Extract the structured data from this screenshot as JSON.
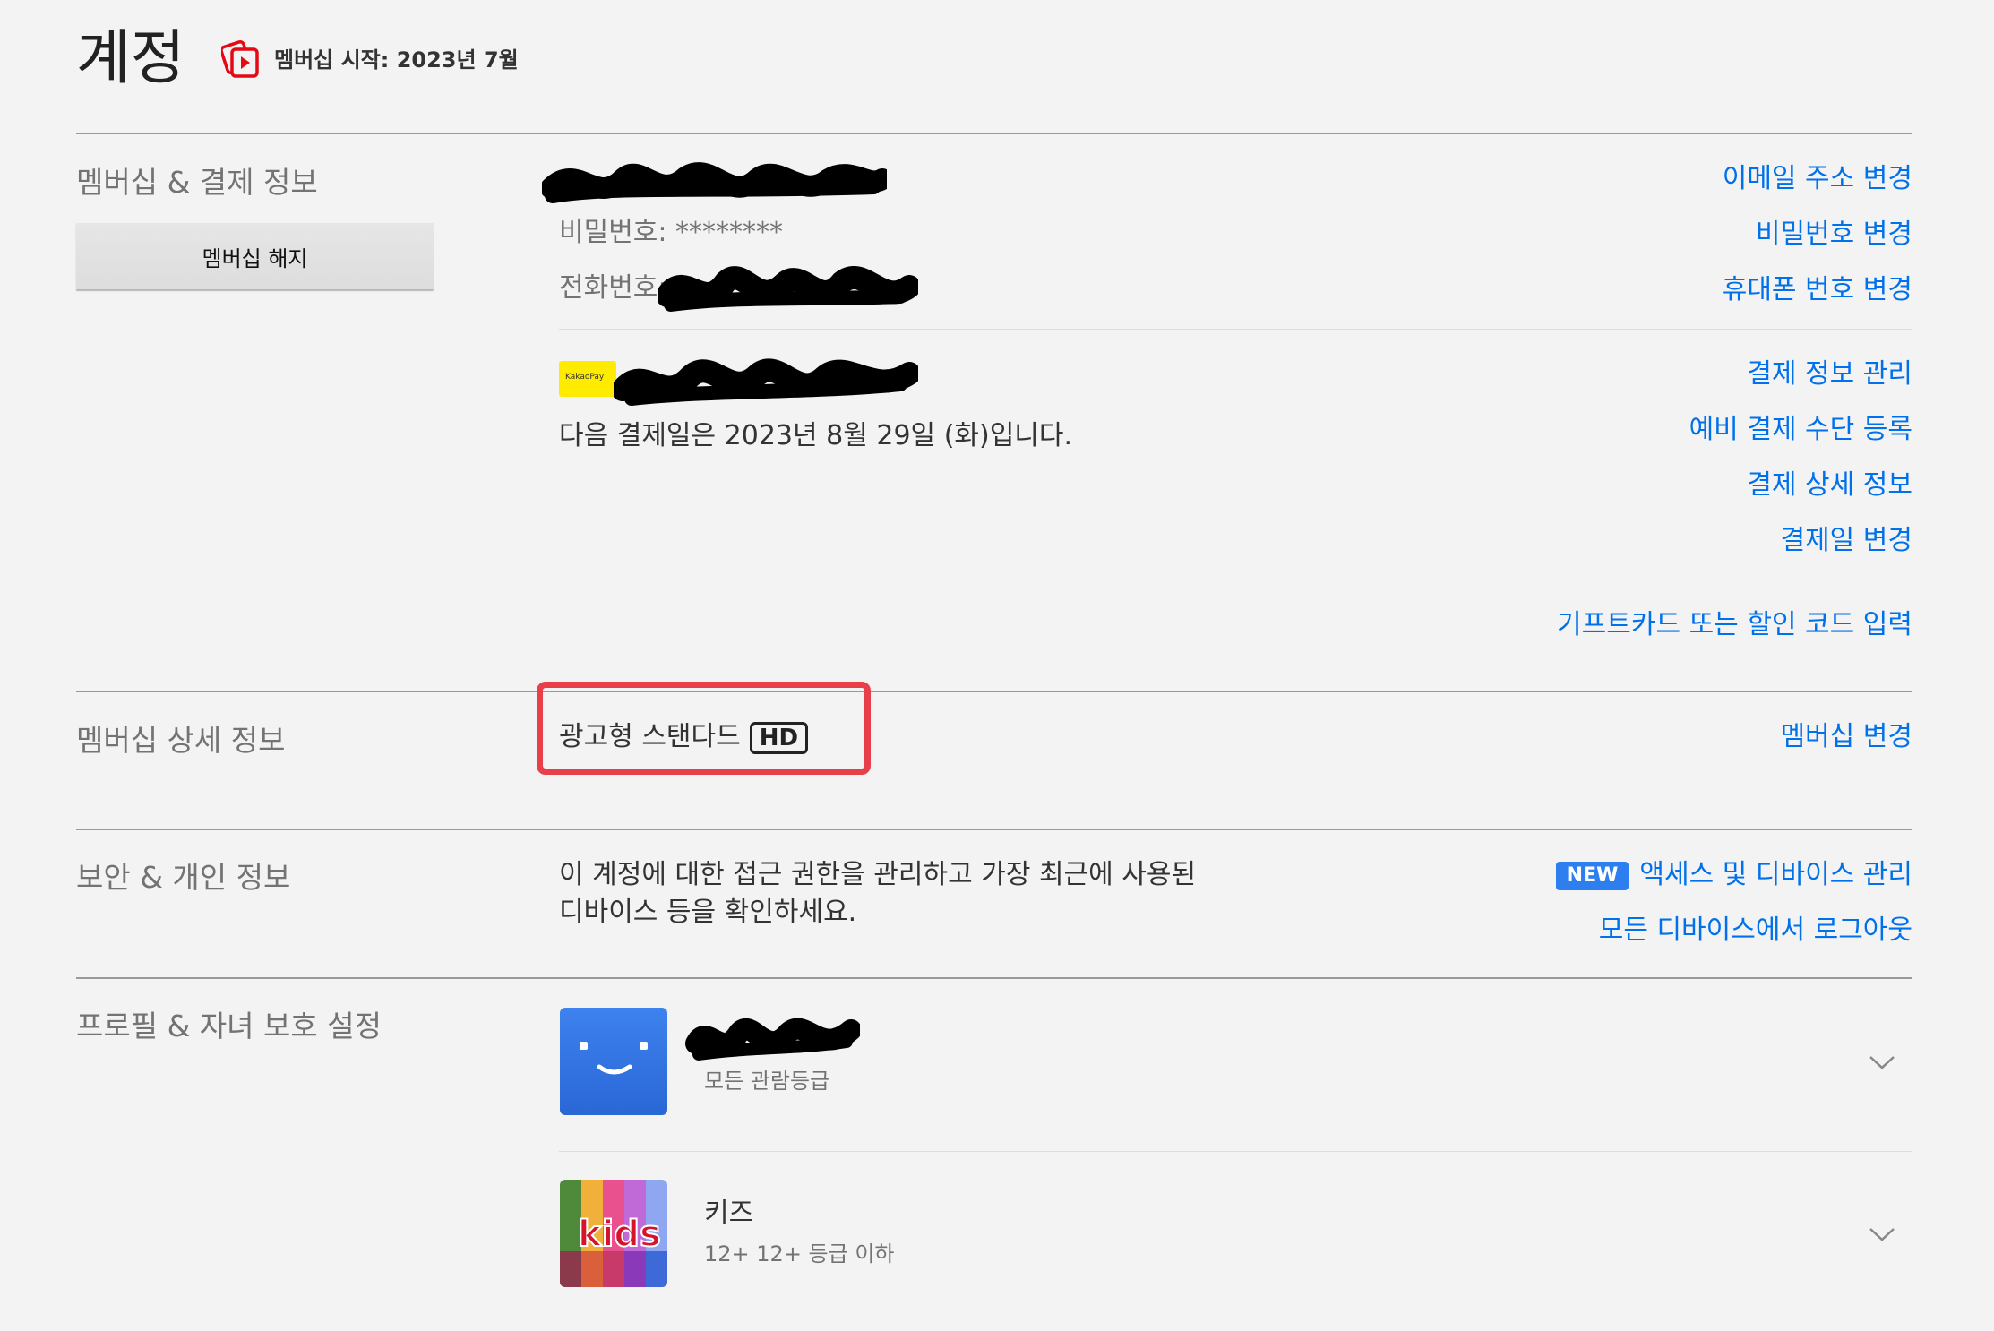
{
  "page": {
    "title": "계정",
    "membership_since": "멤버십 시작: 2023년 7월"
  },
  "membership_billing": {
    "label": "멤버십 & 결제 정보",
    "cancel_button": "멤버십 해지",
    "password_label": "비밀번호: ********",
    "phone_label": "전화번호:",
    "kakao_label": "KakaoPay",
    "next_billing": "다음 결제일은 2023년 8월 29일 (화)입니다.",
    "links": {
      "change_email": "이메일 주소 변경",
      "change_password": "비밀번호 변경",
      "change_phone": "휴대폰 번호 변경",
      "manage_payment": "결제 정보 관리",
      "backup_payment": "예비 결제 수단 등록",
      "billing_details": "결제 상세 정보",
      "change_billing_date": "결제일 변경",
      "gift_code": "기프트카드 또는 할인 코드 입력"
    }
  },
  "plan": {
    "label": "멤버십 상세 정보",
    "plan_name": "광고형 스탠다드",
    "quality_badge": "HD",
    "change_plan": "멤버십 변경"
  },
  "security": {
    "label": "보안 & 개인 정보",
    "description_line1": "이 계정에 대한 접근 권한을 관리하고 가장 최근에 사용된",
    "description_line2": "디바이스 등을 확인하세요.",
    "new_badge": "NEW",
    "manage_access": "액세스 및 디바이스 관리",
    "sign_out_all": "모든 디바이스에서 로그아웃"
  },
  "profiles": {
    "label": "프로필 & 자녀 보호 설정",
    "items": [
      {
        "name": "",
        "rating": "모든 관람등급",
        "icon": "smiley-avatar-icon"
      },
      {
        "name": "키즈",
        "rating": "12+  12+ 등급 이하",
        "avatar_text": "kids",
        "icon": "kids-avatar-icon"
      }
    ]
  },
  "colors": {
    "link": "#0071eb",
    "highlight": "#e8404a",
    "kakao": "#ffeb00",
    "new_badge": "#2d7ff0",
    "avatar_blue": "#2f75e3"
  }
}
